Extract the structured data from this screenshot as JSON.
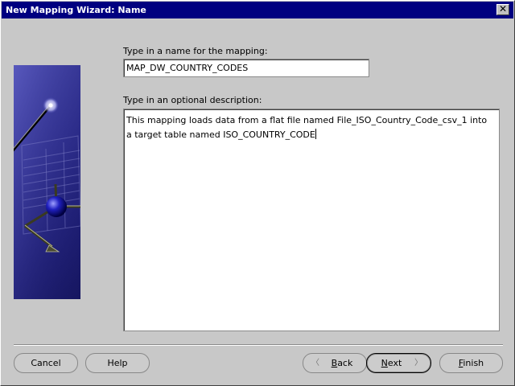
{
  "window": {
    "title": "New Mapping Wizard: Name",
    "close_glyph": "✕"
  },
  "form": {
    "name_label": "Type in a name for the mapping:",
    "name_value": "MAP_DW_COUNTRY_CODES",
    "desc_label": "Type in an optional description:",
    "desc_value": "This mapping loads data from a flat file named File_ISO_Country_Code_csv_1 into\na target table named ISO_COUNTRY_CODE"
  },
  "buttons": {
    "cancel": "Cancel",
    "help": "Help",
    "back_prefix": "",
    "back_mnemonic": "B",
    "back_rest": "ack",
    "next_mnemonic": "N",
    "next_rest": "ext",
    "finish_mnemonic": "F",
    "finish_rest": "inish"
  },
  "icons": {
    "graphic": "wizard-wand-graphic",
    "back_arrow": "chevron-left-icon",
    "next_arrow": "chevron-right-icon"
  },
  "colors": {
    "titlebar": "#000080",
    "dialog": "#c8c8c8"
  }
}
